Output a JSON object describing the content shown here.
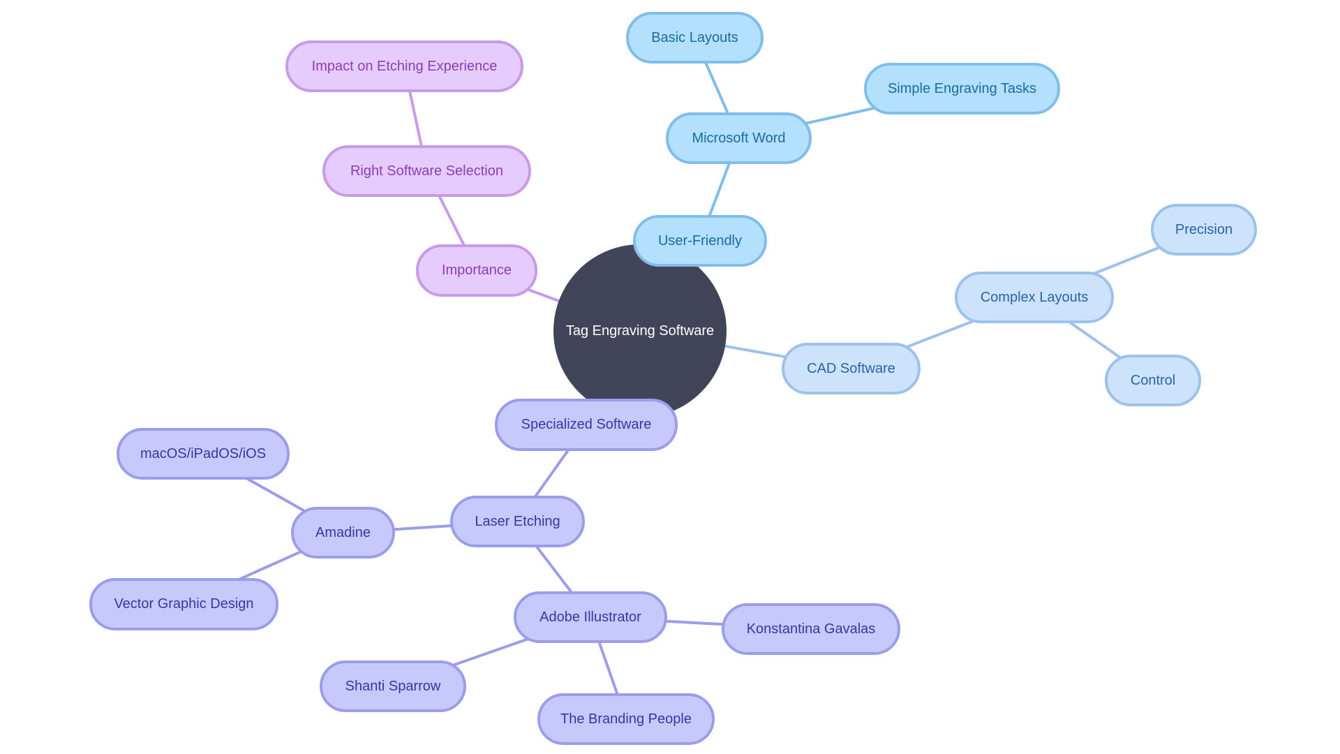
{
  "diagram": {
    "type": "mindmap",
    "root": {
      "id": "root",
      "label": "Tag Engraving Software",
      "fill": "#42455A",
      "text": "#FFFFFF"
    },
    "themes": {
      "purple": {
        "fill": "#E6CCFD",
        "stroke": "#C89AEA",
        "text": "#8A3DB8"
      },
      "sky": {
        "fill": "#B3E0FD",
        "stroke": "#7FBDEB",
        "text": "#1A6AA6"
      },
      "pale": {
        "fill": "#CDE3FB",
        "stroke": "#9CC2EC",
        "text": "#2A62A8"
      },
      "lavender": {
        "fill": "#C7C9FC",
        "stroke": "#9B9DEA",
        "text": "#3337A6"
      }
    },
    "nodes": [
      {
        "id": "importance",
        "label": "Importance",
        "parent": "root",
        "theme": "purple"
      },
      {
        "id": "right-software-selection",
        "label": "Right Software Selection",
        "parent": "importance",
        "theme": "purple"
      },
      {
        "id": "impact-on-etching-experience",
        "label": "Impact on Etching Experience",
        "parent": "right-software-selection",
        "theme": "purple"
      },
      {
        "id": "user-friendly",
        "label": "User-Friendly",
        "parent": "root",
        "theme": "sky"
      },
      {
        "id": "microsoft-word",
        "label": "Microsoft Word",
        "parent": "user-friendly",
        "theme": "sky"
      },
      {
        "id": "basic-layouts",
        "label": "Basic Layouts",
        "parent": "microsoft-word",
        "theme": "sky"
      },
      {
        "id": "simple-engraving-tasks",
        "label": "Simple Engraving Tasks",
        "parent": "microsoft-word",
        "theme": "sky"
      },
      {
        "id": "cad-software",
        "label": "CAD Software",
        "parent": "root",
        "theme": "pale"
      },
      {
        "id": "complex-layouts",
        "label": "Complex Layouts",
        "parent": "cad-software",
        "theme": "pale"
      },
      {
        "id": "precision",
        "label": "Precision",
        "parent": "complex-layouts",
        "theme": "pale"
      },
      {
        "id": "control",
        "label": "Control",
        "parent": "complex-layouts",
        "theme": "pale"
      },
      {
        "id": "specialized-software",
        "label": "Specialized Software",
        "parent": "root",
        "theme": "lavender"
      },
      {
        "id": "laser-etching",
        "label": "Laser Etching",
        "parent": "specialized-software",
        "theme": "lavender"
      },
      {
        "id": "amadine",
        "label": "Amadine",
        "parent": "laser-etching",
        "theme": "lavender"
      },
      {
        "id": "macos-ipados-ios",
        "label": "macOS/iPadOS/iOS",
        "parent": "amadine",
        "theme": "lavender"
      },
      {
        "id": "vector-graphic-design",
        "label": "Vector Graphic Design",
        "parent": "amadine",
        "theme": "lavender"
      },
      {
        "id": "adobe-illustrator",
        "label": "Adobe Illustrator",
        "parent": "laser-etching",
        "theme": "lavender"
      },
      {
        "id": "konstantina-gavalas",
        "label": "Konstantina Gavalas",
        "parent": "adobe-illustrator",
        "theme": "lavender"
      },
      {
        "id": "shanti-sparrow",
        "label": "Shanti Sparrow",
        "parent": "adobe-illustrator",
        "theme": "lavender"
      },
      {
        "id": "the-branding-people",
        "label": "The Branding People",
        "parent": "adobe-illustrator",
        "theme": "lavender"
      }
    ]
  }
}
